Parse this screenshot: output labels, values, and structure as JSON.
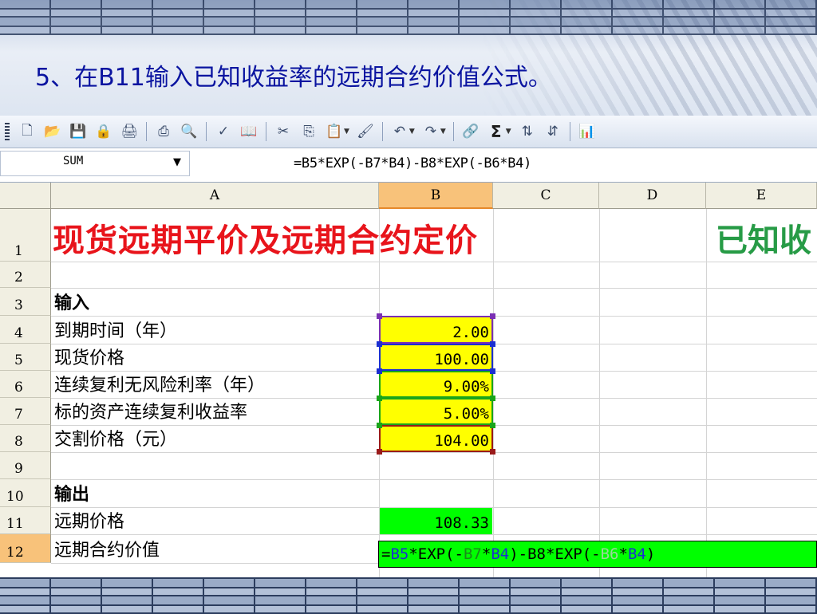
{
  "slide": {
    "title": "5、在B11输入已知收益率的远期合约价值公式。"
  },
  "toolbar": {
    "icons": [
      "new-icon",
      "open-icon",
      "save-icon",
      "permission-icon",
      "print-preview-icon",
      "print-icon",
      "preview-icon",
      "spelling-icon",
      "research-icon",
      "cut-icon",
      "copy-icon",
      "paste-icon",
      "format-painter-icon",
      "undo-icon",
      "redo-icon",
      "hyperlink-icon",
      "autosum-icon",
      "sort-ascending-icon",
      "sort-descending-icon",
      "chart-icon"
    ],
    "sigma": "Σ"
  },
  "formula_bar": {
    "name_box": "SUM",
    "formula": "=B5*EXP(-B7*B4)-B8*EXP(-B6*B4)"
  },
  "columns": [
    "A",
    "B",
    "C",
    "D",
    "E"
  ],
  "rows": [
    "1",
    "2",
    "3",
    "4",
    "5",
    "6",
    "7",
    "8",
    "9",
    "10",
    "11",
    "12"
  ],
  "cells": {
    "A1": "现货远期平价及远期合约定价",
    "E1": "已知收",
    "A3": "输入",
    "A4": "到期时间（年）",
    "B4": "2.00",
    "A5": "现货价格",
    "B5": "100.00",
    "A6": "连续复利无风险利率（年）",
    "B6": "9.00%",
    "A7": "标的资产连续复利收益率",
    "B7": "5.00%",
    "A8": "交割价格（元）",
    "B8": "104.00",
    "A10": "输出",
    "A11": "远期价格",
    "B11": "108.33",
    "A12": "远期合约价值"
  },
  "edit_formula": {
    "p1": "=",
    "p2": "B5",
    "p3": "*EXP(-",
    "p4": "B7",
    "p5": "*",
    "p6": "B4",
    "p7": ")-B8*EXP(-",
    "p8": "B6",
    "p9": "*",
    "p10": "B4",
    "p11": ")"
  }
}
